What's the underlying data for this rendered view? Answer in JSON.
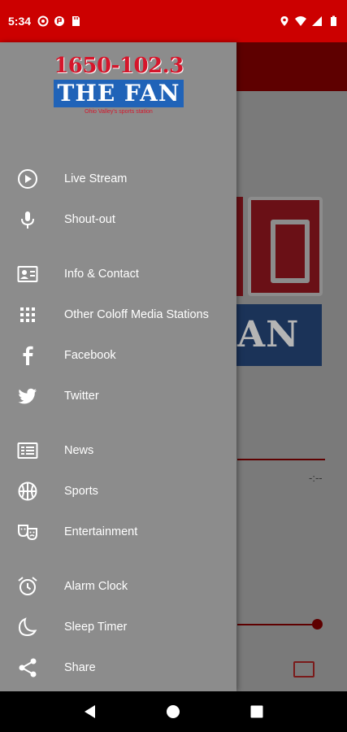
{
  "status_bar": {
    "time": "5:34",
    "left_icons": [
      "circle-dot-icon",
      "cloud-icon",
      "sd-card-icon"
    ],
    "right_icons": [
      "location-icon",
      "wifi-icon",
      "signal-icon",
      "battery-icon"
    ]
  },
  "drawer": {
    "logo": {
      "frequency": "1650-102.3",
      "name": "THE FAN",
      "tagline": "Ohio Valley's sports station"
    },
    "items": [
      {
        "label": "Live Stream",
        "icon": "play-circle-icon"
      },
      {
        "label": "Shout-out",
        "icon": "microphone-icon"
      },
      {
        "label": "Info & Contact",
        "icon": "contact-card-icon"
      },
      {
        "label": "Other Coloff Media Stations",
        "icon": "grid-icon"
      },
      {
        "label": "Facebook",
        "icon": "facebook-icon"
      },
      {
        "label": "Twitter",
        "icon": "twitter-icon"
      },
      {
        "label": "News",
        "icon": "news-icon"
      },
      {
        "label": "Sports",
        "icon": "basketball-icon"
      },
      {
        "label": "Entertainment",
        "icon": "theater-masks-icon"
      },
      {
        "label": "Alarm Clock",
        "icon": "alarm-clock-icon"
      },
      {
        "label": "Sleep Timer",
        "icon": "moon-icon"
      },
      {
        "label": "Share",
        "icon": "share-icon"
      }
    ]
  },
  "background_app": {
    "logo_text": "AN",
    "time_readout": "-:--"
  },
  "nav_bar": {
    "buttons": [
      "back-icon",
      "home-icon",
      "recents-icon"
    ]
  },
  "colors": {
    "status_bar": "#cc0000",
    "drawer": "#8c8c8c",
    "logo_red": "#d5162b",
    "logo_blue": "#2063b8"
  }
}
